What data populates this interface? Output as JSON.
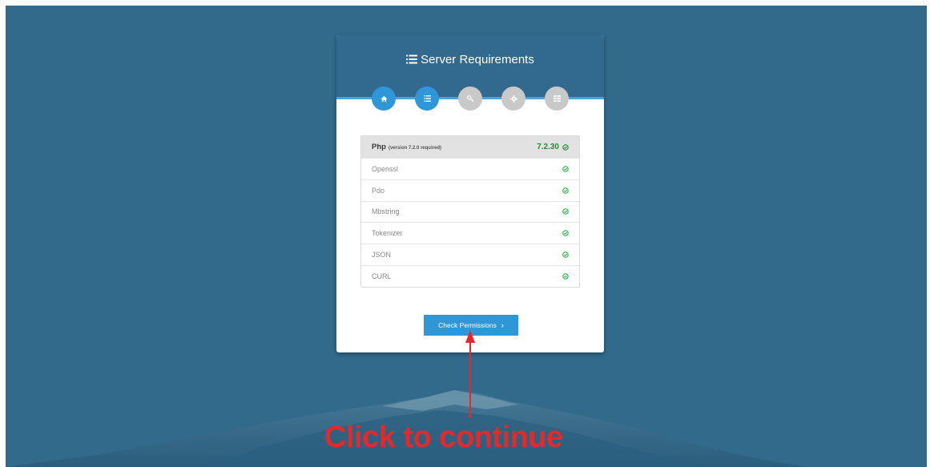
{
  "header": {
    "title": "Server Requirements",
    "icon": "list-icon"
  },
  "steps": [
    {
      "icon": "home-icon",
      "state": "complete"
    },
    {
      "icon": "list-icon",
      "state": "current"
    },
    {
      "icon": "key-icon",
      "state": "pending"
    },
    {
      "icon": "gear-icon",
      "state": "pending"
    },
    {
      "icon": "server-icon",
      "state": "pending"
    }
  ],
  "requirements": {
    "php": {
      "name": "Php",
      "note": "(version 7.2.0 required)",
      "version": "7.2.30",
      "status": "ok"
    },
    "extensions": [
      {
        "name": "Openssl",
        "status": "ok"
      },
      {
        "name": "Pdo",
        "status": "ok"
      },
      {
        "name": "Mbstring",
        "status": "ok"
      },
      {
        "name": "Tokenizer",
        "status": "ok"
      },
      {
        "name": "JSON",
        "status": "ok"
      },
      {
        "name": "CURL",
        "status": "ok"
      }
    ]
  },
  "actions": {
    "continue_label": "Check Permissions",
    "continue_chevron": "›"
  },
  "annotation": {
    "text": "Click to continue"
  },
  "colors": {
    "background": "#326a8c",
    "header": "#31698f",
    "accent": "#2f96d8",
    "success": "#2d8a34",
    "annotation": "#e5282a"
  }
}
